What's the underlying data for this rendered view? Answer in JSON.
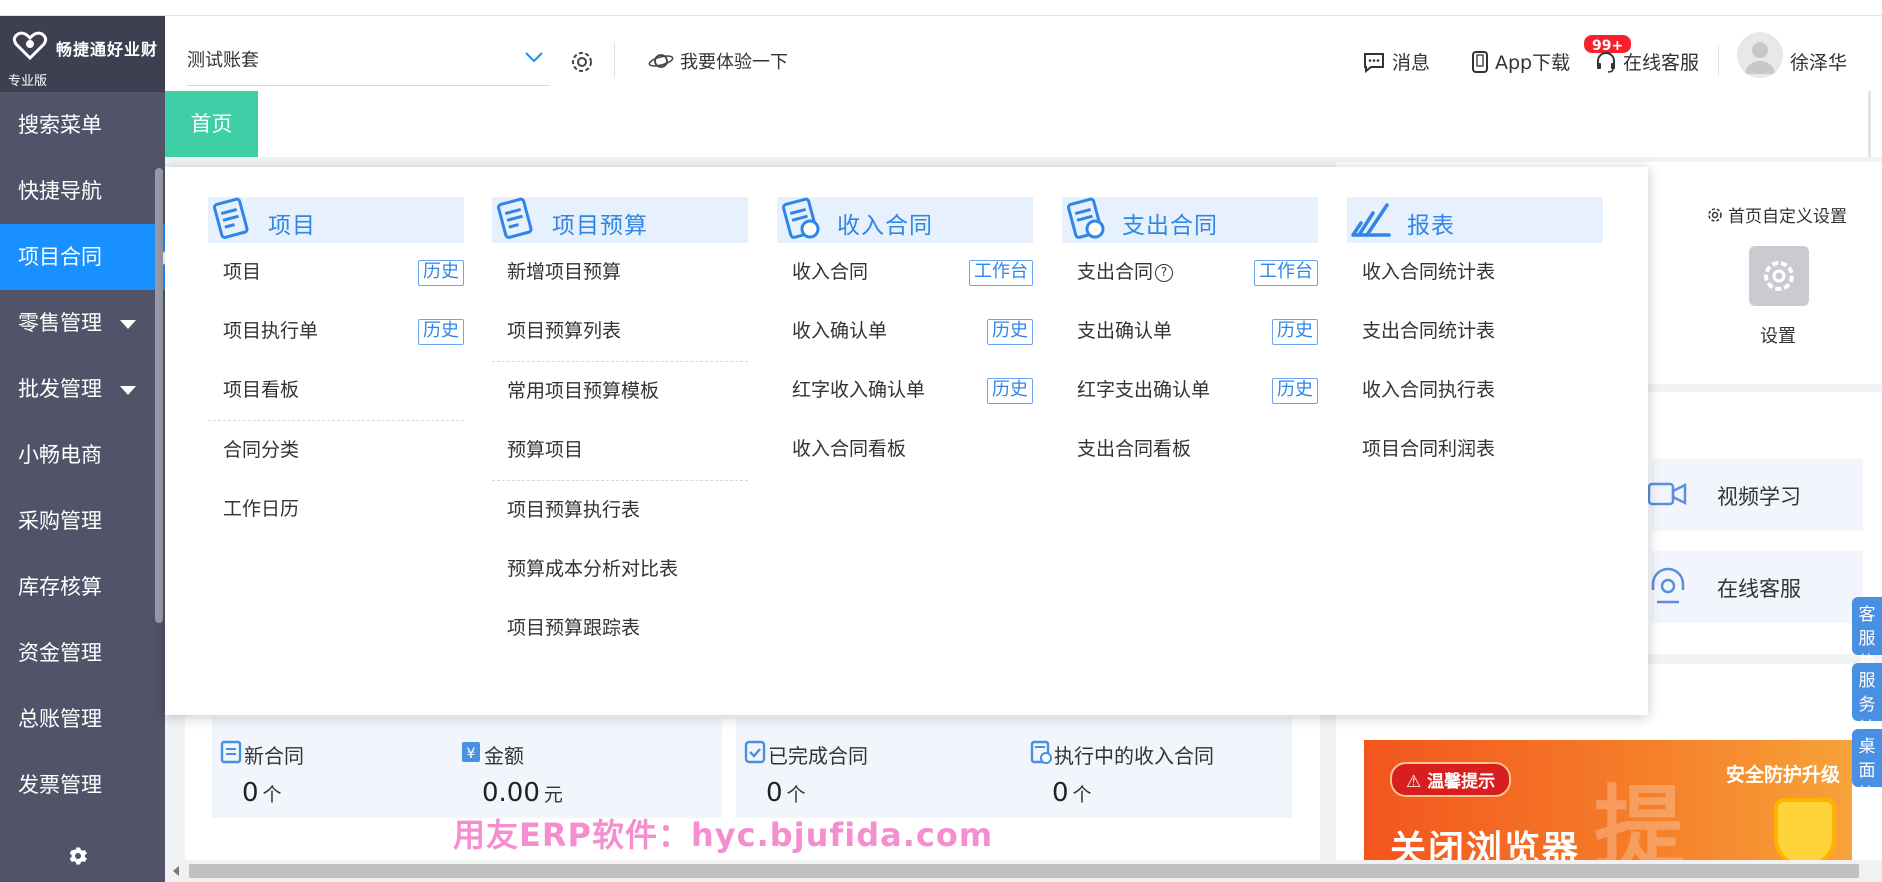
{
  "sidebar": {
    "brand": "畅捷通好业财",
    "edition": "专业版",
    "items": [
      {
        "label": "搜索菜单"
      },
      {
        "label": "快捷导航"
      },
      {
        "label": "项目合同"
      },
      {
        "label": "零售管理"
      },
      {
        "label": "批发管理"
      },
      {
        "label": "小畅电商"
      },
      {
        "label": "采购管理"
      },
      {
        "label": "库存核算"
      },
      {
        "label": "资金管理"
      },
      {
        "label": "总账管理"
      },
      {
        "label": "发票管理"
      }
    ],
    "active_item": "项目合同"
  },
  "header": {
    "account": "测试账套",
    "try_label": "我要体验一下",
    "messages_label": "消息",
    "messages_badge": "99+",
    "app_download": "App下载",
    "online_service": "在线客服",
    "username": "徐泽华"
  },
  "tabs": {
    "home": "首页"
  },
  "mega_menu": {
    "columns": [
      {
        "title": "项目",
        "items": [
          {
            "label": "项目",
            "tag": "历史"
          },
          {
            "label": "项目执行单",
            "tag": "历史"
          },
          {
            "label": "项目看板"
          },
          {
            "label": "合同分类"
          },
          {
            "label": "工作日历"
          }
        ]
      },
      {
        "title": "项目预算",
        "items": [
          {
            "label": "新增项目预算"
          },
          {
            "label": "项目预算列表"
          },
          {
            "label": "常用项目预算模板"
          },
          {
            "label": "预算项目"
          },
          {
            "label": "项目预算执行表"
          },
          {
            "label": "预算成本分析对比表"
          },
          {
            "label": "项目预算跟踪表"
          }
        ]
      },
      {
        "title": "收入合同",
        "items": [
          {
            "label": "收入合同",
            "tag": "工作台"
          },
          {
            "label": "收入确认单",
            "tag": "历史"
          },
          {
            "label": "红字收入确认单",
            "tag": "历史"
          },
          {
            "label": "收入合同看板"
          }
        ]
      },
      {
        "title": "支出合同",
        "items": [
          {
            "label": "支出合同",
            "tag": "工作台"
          },
          {
            "label": "支出确认单",
            "tag": "历史"
          },
          {
            "label": "红字支出确认单",
            "tag": "历史"
          },
          {
            "label": "支出合同看板"
          }
        ]
      },
      {
        "title": "报表",
        "items": [
          {
            "label": "收入合同统计表"
          },
          {
            "label": "支出合同统计表"
          },
          {
            "label": "收入合同执行表"
          },
          {
            "label": "项目合同利润表"
          }
        ]
      }
    ]
  },
  "home": {
    "custom_settings": "首页自定义设置",
    "settings_label": "设置",
    "video_learning": "视频学习",
    "online_service": "在线客服",
    "stats": [
      {
        "label": "新合同",
        "value": "0",
        "unit": "个"
      },
      {
        "label": "金额",
        "value": "0.00",
        "unit": "元"
      },
      {
        "label": "已完成合同",
        "value": "0",
        "unit": "个"
      },
      {
        "label": "执行中的收入合同",
        "value": "0",
        "unit": "个"
      }
    ],
    "promo": {
      "tip": "温馨提示",
      "headline": "关闭浏览器",
      "security": "安全防护升级",
      "stamp": "提"
    },
    "float_tabs": [
      "客服热线",
      "服务社区",
      "桌面快捷"
    ]
  },
  "watermark": "用友ERP软件：hyc.bjufida.com",
  "colors": {
    "sidebar_bg": "#515468",
    "active_blue": "#1890ff",
    "tab_green": "#3ecfa7",
    "menu_blue": "#2f86e8",
    "badge_red": "#f5222d"
  }
}
